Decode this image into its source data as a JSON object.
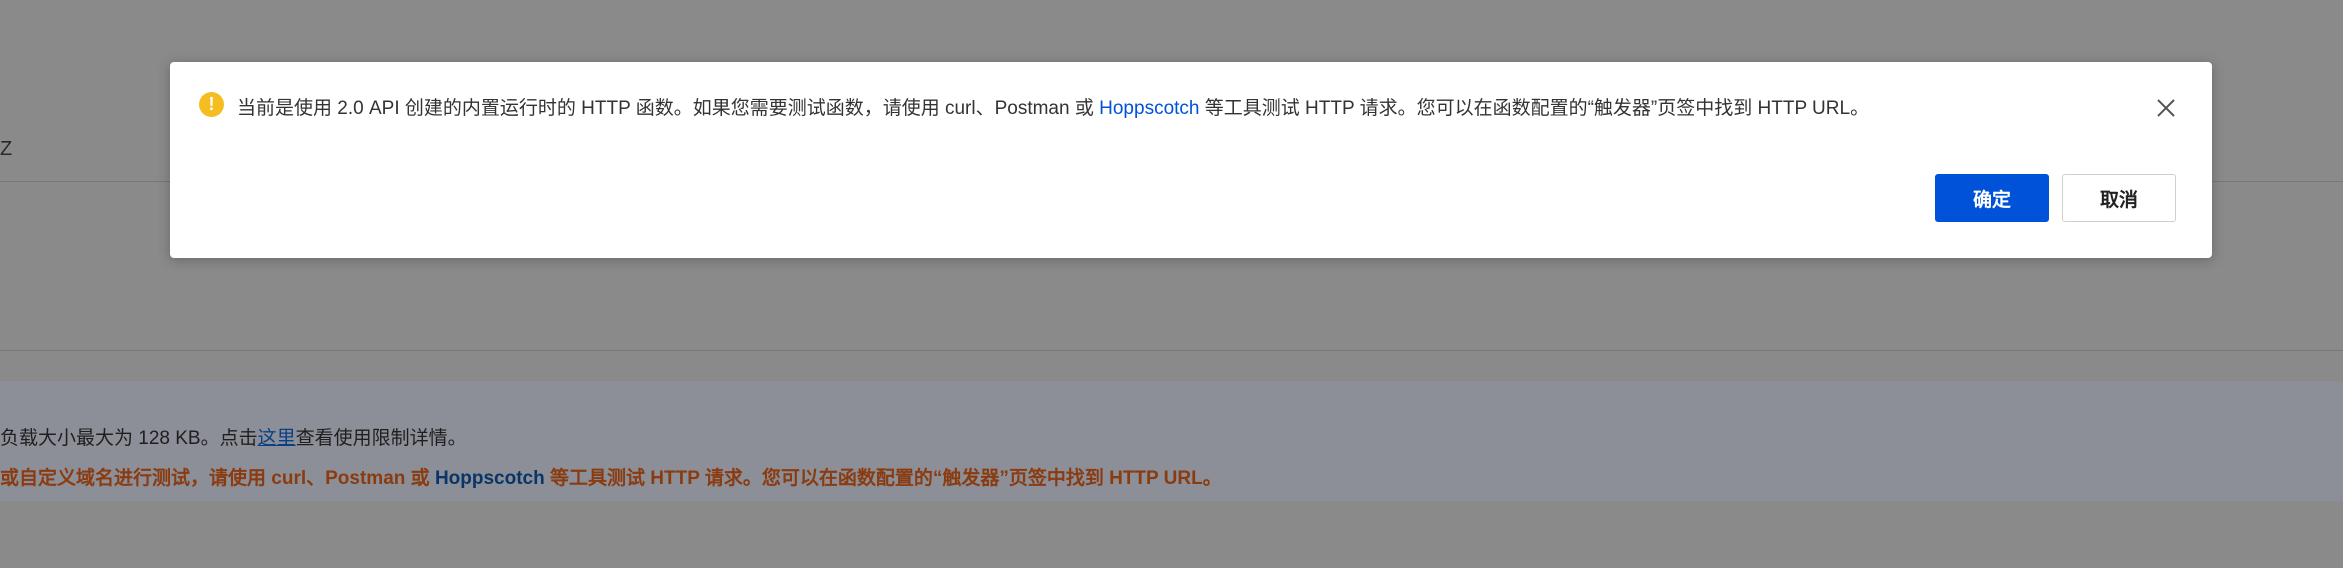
{
  "background": {
    "top_fragment": "Z",
    "info_text_before_link": "负载大小最大为 128 KB。点击",
    "info_link": "这里",
    "info_text_after_link": "查看使用限制详情。",
    "warning_text_before_link": "或自定义域名进行测试，请使用 curl、Postman 或 ",
    "warning_link": "Hoppscotch",
    "warning_text_after_link": " 等工具测试 HTTP 请求。您可以在函数配置的“触发器”页签中找到 HTTP URL。"
  },
  "dialog": {
    "icon": "warning-icon",
    "message_before_link": "当前是使用 2.0 API 创建的内置运行时的 HTTP 函数。如果您需要测试函数，请使用 curl、Postman 或 ",
    "message_link": "Hoppscotch",
    "message_after_link": " 等工具测试 HTTP 请求。您可以在函数配置的“触发器”页签中找到 HTTP URL。",
    "confirm_label": "确定",
    "cancel_label": "取消",
    "close_icon": "close-icon"
  },
  "colors": {
    "overlay": "#8a8a8a",
    "primary": "#0052d9",
    "warning_icon": "#f5bd1f",
    "warning_text": "#8a3b10"
  }
}
